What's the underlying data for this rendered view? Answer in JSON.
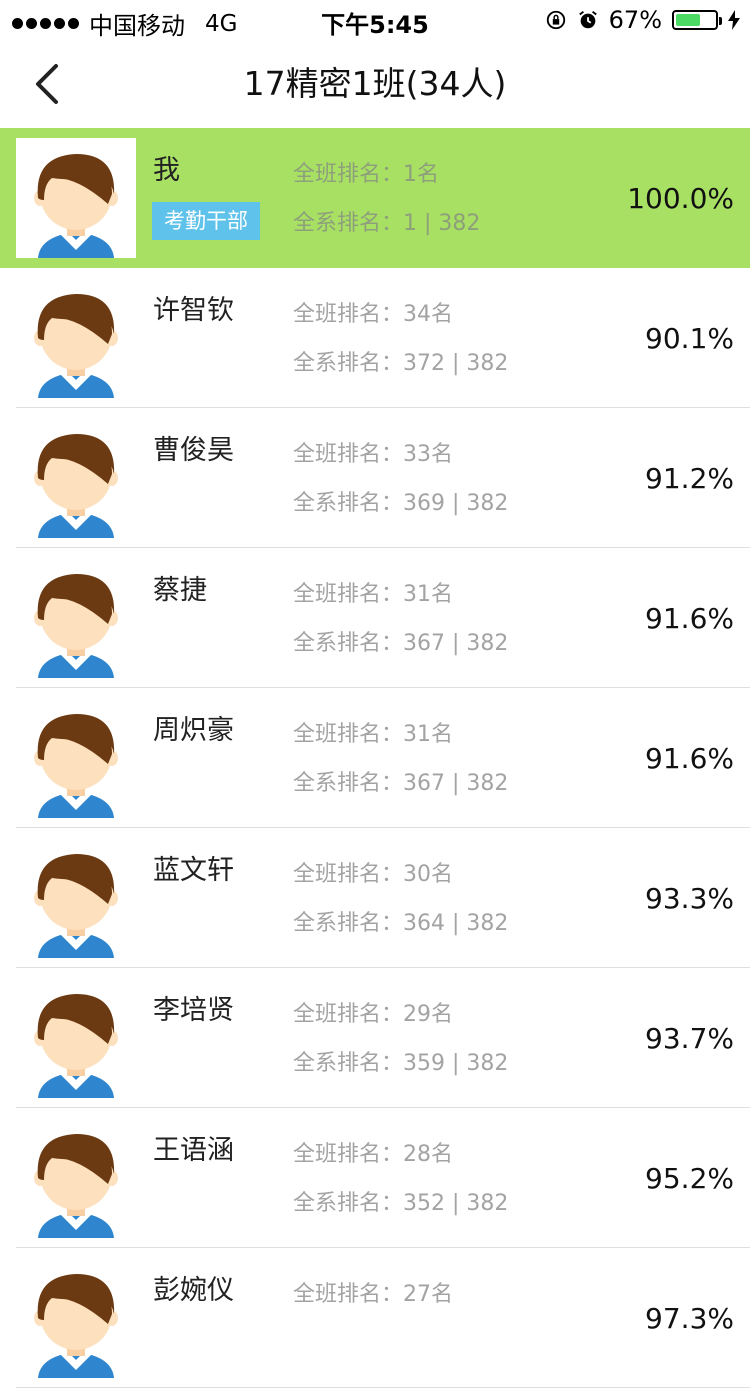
{
  "status_bar": {
    "carrier": "中国移动",
    "network": "4G",
    "time": "下午5:45",
    "battery_percent": "67%",
    "battery_level": 0.67,
    "icons": [
      "signal-dots-icon",
      "orientation-lock-icon",
      "alarm-icon",
      "battery-icon",
      "charging-bolt-icon"
    ]
  },
  "navbar": {
    "title": "17精密1班(34人)",
    "back_icon": "chevron-left-icon"
  },
  "colors": {
    "highlight_row": "#a8e064",
    "badge": "#5ec2eb",
    "muted_text": "#a3a3a3",
    "hair": "#6b3a12",
    "skin": "#fde0bd",
    "shirt": "#2f86cf"
  },
  "students": [
    {
      "name": "我",
      "badge": "考勤干部",
      "class_rank": "全班排名：1名",
      "dept_rank": "全系排名：1 | 382",
      "percent": "100.0%",
      "is_me": true
    },
    {
      "name": "许智钦",
      "class_rank": "全班排名：34名",
      "dept_rank": "全系排名：372 | 382",
      "percent": "90.1%"
    },
    {
      "name": "曹俊昊",
      "class_rank": "全班排名：33名",
      "dept_rank": "全系排名：369 | 382",
      "percent": "91.2%"
    },
    {
      "name": "蔡捷",
      "class_rank": "全班排名：31名",
      "dept_rank": "全系排名：367 | 382",
      "percent": "91.6%"
    },
    {
      "name": "周炽豪",
      "class_rank": "全班排名：31名",
      "dept_rank": "全系排名：367 | 382",
      "percent": "91.6%"
    },
    {
      "name": "蓝文轩",
      "class_rank": "全班排名：30名",
      "dept_rank": "全系排名：364 | 382",
      "percent": "93.3%"
    },
    {
      "name": "李培贤",
      "class_rank": "全班排名：29名",
      "dept_rank": "全系排名：359 | 382",
      "percent": "93.7%"
    },
    {
      "name": "王语涵",
      "class_rank": "全班排名：28名",
      "dept_rank": "全系排名：352 | 382",
      "percent": "95.2%"
    },
    {
      "name": "彭婉仪",
      "class_rank": "全班排名：27名",
      "dept_rank": "",
      "percent": "97.3%"
    }
  ]
}
